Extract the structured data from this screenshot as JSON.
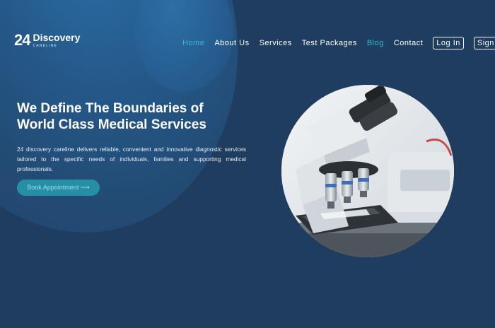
{
  "brand": {
    "mark": "24",
    "name": "Discovery",
    "tagline": "CARELINE"
  },
  "nav": {
    "items": [
      {
        "label": "Home",
        "active": true
      },
      {
        "label": "About Us",
        "active": false
      },
      {
        "label": "Services",
        "active": false
      },
      {
        "label": "Test Packages",
        "active": false
      },
      {
        "label": "Blog",
        "active": true
      },
      {
        "label": "Contact",
        "active": false
      }
    ],
    "login_label": "Log In",
    "signup_label": "Sign Up"
  },
  "hero": {
    "title_line1": "We Define The Boundaries of",
    "title_line2": "World Class Medical Services",
    "description": "24 discovery careline delivers reliable, convenient and innovative diagnostic services tailored to the specific needs of individuals, families and supporting medical professionals.",
    "cta_label": "Book Appointment ⟶",
    "image_subject": "microscope-photo"
  },
  "colors": {
    "background": "#1f3d5e",
    "accent": "#3cbccf",
    "cta": "#278fa5"
  }
}
